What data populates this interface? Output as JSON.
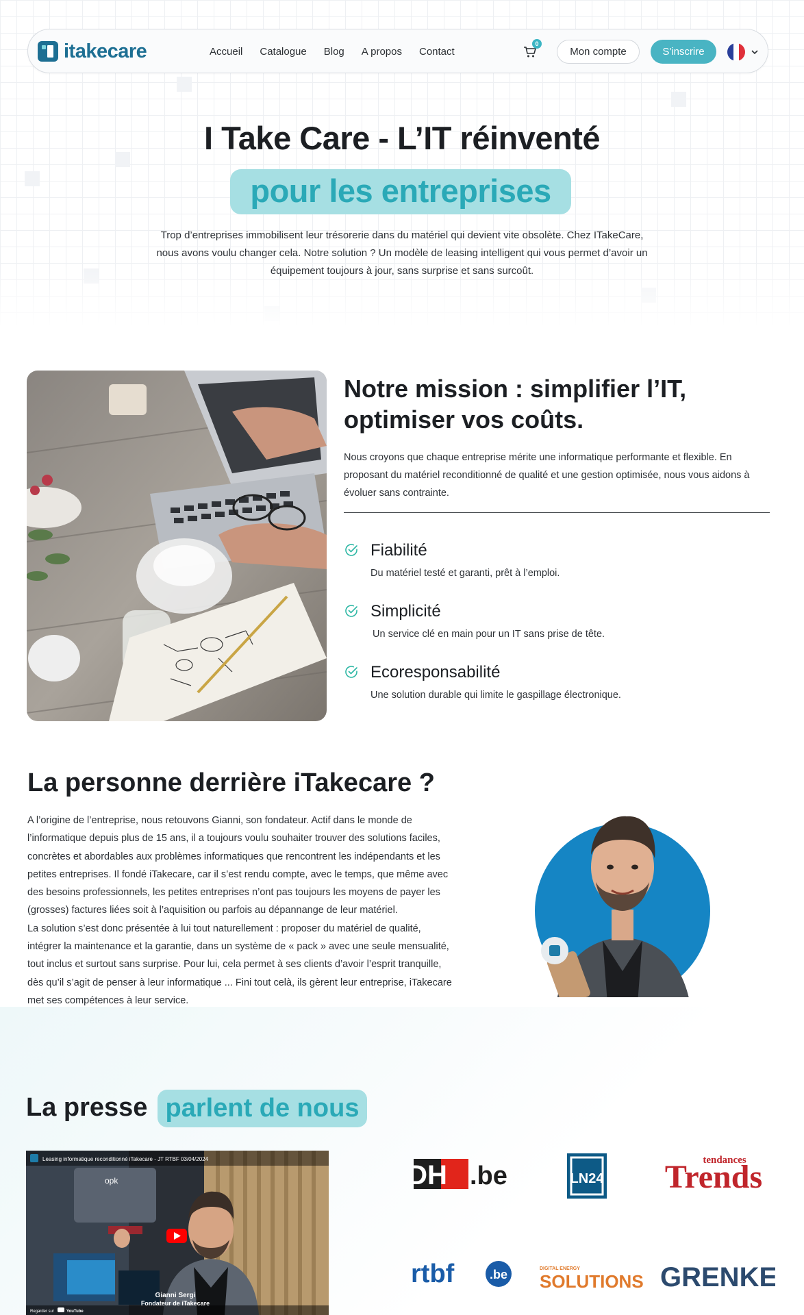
{
  "header": {
    "logo_text": "itakecare",
    "nav": [
      "Accueil",
      "Catalogue",
      "Blog",
      "A propos",
      "Contact"
    ],
    "cart_count": "0",
    "account_label": "Mon compte",
    "signup_label": "S'inscrire",
    "language_flag": "fr-flag-icon",
    "colors": {
      "accent": "#49b4c3",
      "brand": "#1d6f93"
    }
  },
  "hero": {
    "title": "I Take Care - L’IT réinventé",
    "highlight": "pour les entreprises",
    "description": "Trop d’entreprises immobilisent leur trésorerie dans du matériel qui devient vite obsolète. Chez ITakeCare, nous avons voulu changer cela. Notre solution ? Un modèle de leasing intelligent qui vous permet d’avoir un équipement toujours à jour, sans surprise et sans surcoût."
  },
  "mission": {
    "title": "Notre mission : simplifier l’IT, optimiser vos coûts.",
    "description": "Nous croyons que chaque entreprise mérite une informatique performante et flexible. En proposant du matériel reconditionné de qualité et une gestion optimisée, nous vous aidons à évoluer sans contrainte.",
    "features": [
      {
        "title": "Fiabilité",
        "desc": "Du matériel testé et garanti, prêt à l’emploi."
      },
      {
        "title": "Simplicité",
        "desc": "Un service clé en main pour un IT sans prise de tête."
      },
      {
        "title": "Ecoresponsabilité",
        "desc": "Une solution durable qui limite le gaspillage électronique."
      }
    ]
  },
  "about": {
    "title": "La personne derrière iTakecare ?",
    "paragraph1": "A l’origine de l’entreprise, nous retouvons Gianni, son fondateur. Actif dans le monde de l’informatique depuis plus de 15 ans, il a toujours voulu souhaiter trouver des solutions faciles, concrètes et abordables aux problèmes informatiques que rencontrent les indépendants et les petites entreprises. Il fondé iTakecare, car il s’est rendu compte, avec le temps, que même avec des besoins professionnels, les petites entreprises n’ont pas toujours les moyens de payer les (grosses) factures liées soit à l’aquisition ou parfois au dépannange de leur matériel.",
    "paragraph2": "La solution s’est donc présentée à lui tout naturellement : proposer du matériel de qualité, intégrer la maintenance et la garantie, dans un système de « pack » avec une seule mensualité, tout inclus et surtout sans surprise. Pour lui, cela permet à ses clients d’avoir l’esprit tranquille, dès qu’il s’agit de penser à leur informatique ... Fini tout celà, ils gèrent leur entreprise, iTakecare met ses compétences à leur service."
  },
  "press": {
    "title": "La presse",
    "highlight": "parlent de nous",
    "video": {
      "top_caption": "Leasing informatique reconditionné iTakecare - JT RTBF 03/04/2024",
      "name": "Gianni Sergi",
      "role": "Fondateur de iTakecare",
      "watch_on": "Regarder sur",
      "platform": "YouTube",
      "screen_word": "opk"
    },
    "logos": {
      "dh_main": "DH",
      "dh_suffix": ".be",
      "ln24": "LN24",
      "trends_small": "tendances",
      "trends_big": "Trends",
      "rtbf": "rtbf",
      "rtbf_suffix": ".be",
      "ses_small": "DIGITAL ENERGY",
      "ses_big": "SOLUTIONS",
      "grenke": "GRENKE"
    }
  }
}
